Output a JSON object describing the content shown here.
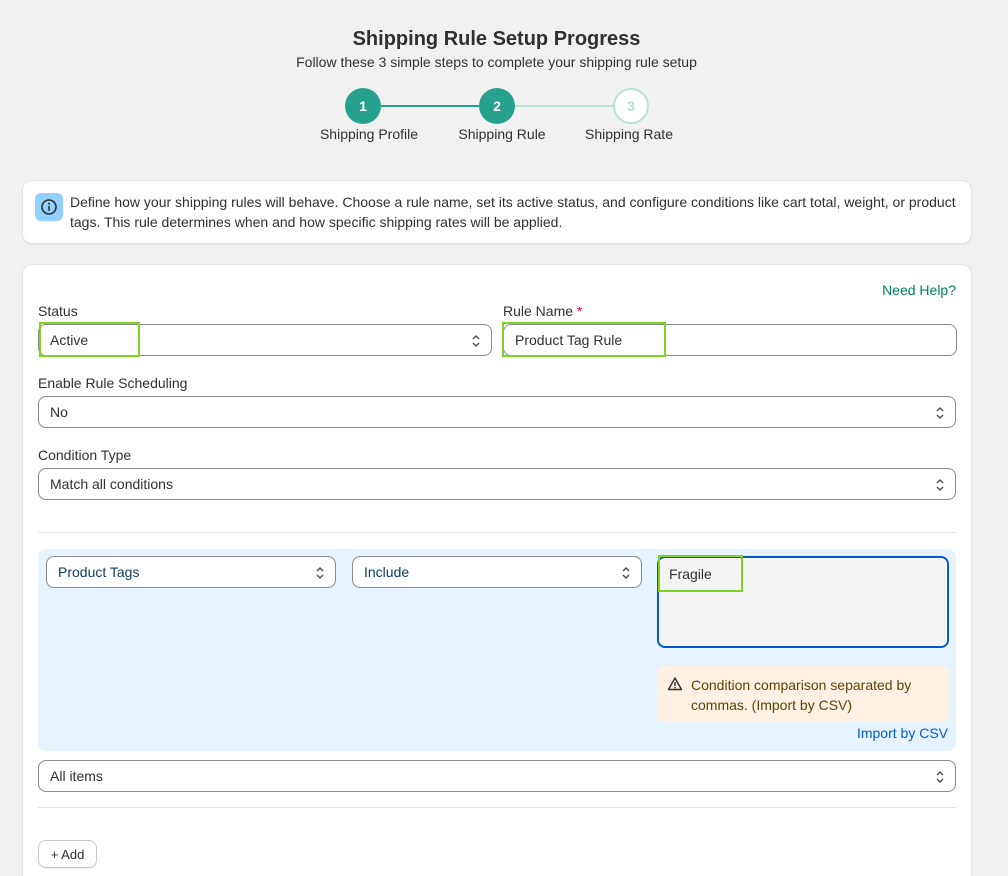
{
  "header": {
    "title": "Shipping Rule Setup Progress",
    "subtitle": "Follow these 3 simple steps to complete your shipping rule setup"
  },
  "steps": [
    {
      "number": "1",
      "label": "Shipping Profile",
      "state": "complete"
    },
    {
      "number": "2",
      "label": "Shipping Rule",
      "state": "current"
    },
    {
      "number": "3",
      "label": "Shipping Rate",
      "state": "upcoming"
    }
  ],
  "info_banner": {
    "icon": "info-icon",
    "text": "Define how your shipping rules will behave. Choose a rule name, set its active status, and configure conditions like cart total, weight, or product tags. This rule determines when and how specific shipping rates will be applied."
  },
  "form": {
    "need_help": "Need Help?",
    "status_label": "Status",
    "status_value": "Active",
    "rule_name_label": "Rule Name",
    "rule_name_required": "*",
    "rule_name_value": "Product Tag Rule",
    "scheduling_label": "Enable Rule Scheduling",
    "scheduling_value": "No",
    "condition_type_label": "Condition Type",
    "condition_type_value": "Match all conditions"
  },
  "condition": {
    "field_value": "Product Tags",
    "operator_value": "Include",
    "tags_value": "Fragile",
    "warning_text": "Condition comparison separated by commas. (Import by CSV)",
    "import_link": "Import by CSV"
  },
  "applies_to_value": "All items",
  "add_button": "+ Add",
  "colors": {
    "accent": "#25a18e",
    "highlight": "#7ed321",
    "condition_bg": "#e7f3fe",
    "warning_bg": "#fff1e3",
    "link": "#005bd3"
  }
}
